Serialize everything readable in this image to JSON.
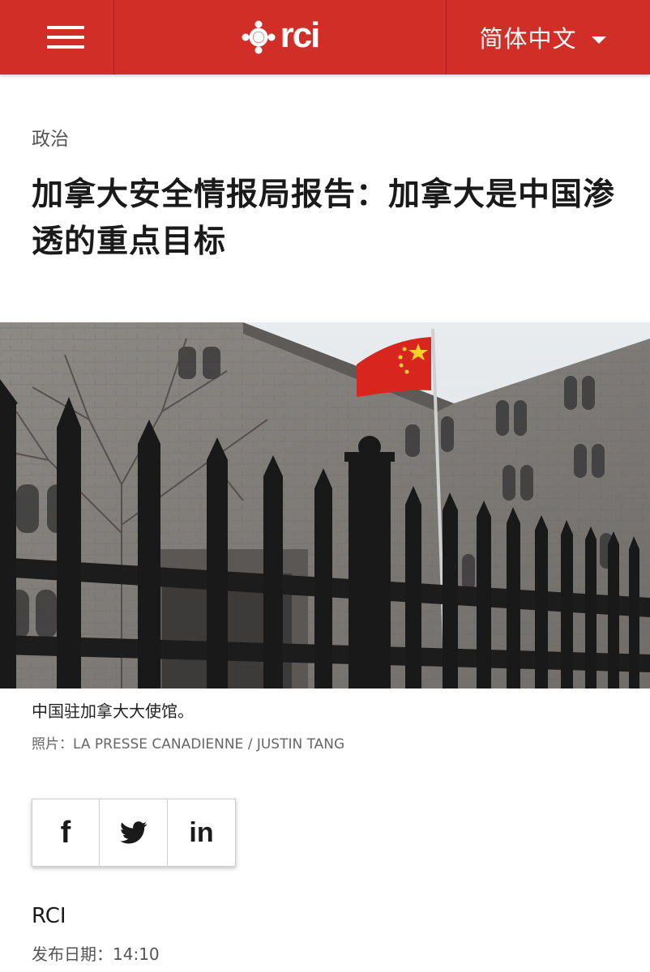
{
  "header": {
    "menu_icon": "hamburger-menu-icon",
    "logo_text": "rci",
    "logo_icon": "cbc-gem-icon",
    "language_label": "简体中文",
    "language_icon": "caret-down-icon",
    "brand_color": "#d22e28"
  },
  "article": {
    "section": "政治",
    "headline": "加拿大安全情报局报告：加拿大是中国渗透的重点目标",
    "image_caption": "中国驻加拿大大使馆。",
    "photo_credit_label": "照片：",
    "photo_credit": "LA PRESSE CANADIENNE / JUSTIN TANG",
    "author": "RCI",
    "published_label": "发布日期：",
    "published_time": "14:10"
  },
  "share": {
    "facebook_label": "f",
    "facebook_icon": "facebook-icon",
    "twitter_icon": "twitter-icon",
    "linkedin_label": "in",
    "linkedin_icon": "linkedin-icon"
  }
}
